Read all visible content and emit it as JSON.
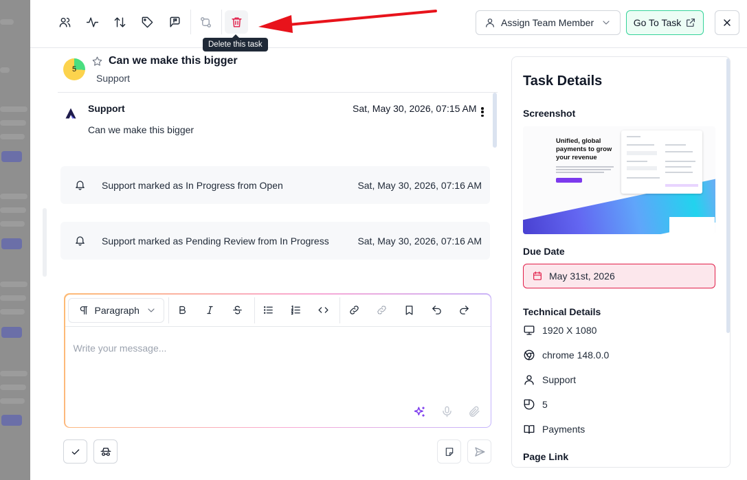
{
  "toolbar": {
    "delete_tooltip": "Delete this task",
    "assign_label": "Assign Team Member",
    "goto_label": "Go To Task"
  },
  "task": {
    "priority": "5",
    "title": "Can we make this bigger",
    "project": "Support"
  },
  "message": {
    "author": "Support",
    "time": "Sat, May 30, 2026, 07:15 AM",
    "body": "Can we make this bigger"
  },
  "events": [
    {
      "text": "Support marked as In Progress from Open",
      "time": "Sat, May 30, 2026, 07:16 AM"
    },
    {
      "text": "Support marked as Pending Review from In Progress",
      "time": "Sat, May 30, 2026, 07:16 AM"
    }
  ],
  "editor": {
    "format_label": "Paragraph",
    "placeholder": "Write your message..."
  },
  "details": {
    "title": "Task Details",
    "screenshot_heading": "Screenshot",
    "screenshot_headline": "Unified, global payments to grow your revenue",
    "due_heading": "Due Date",
    "due_date": "May 31st, 2026",
    "tech_heading": "Technical Details",
    "resolution": "1920 X 1080",
    "browser": "chrome 148.0.0",
    "reporter": "Support",
    "priority": "5",
    "category": "Payments",
    "page_link_heading": "Page Link"
  },
  "colors": {
    "accent_delete": "#e11d48",
    "goto_bg": "#ecfdf5",
    "goto_border": "#34d399",
    "due_bg": "#fce7ec",
    "arrow": "#e8131b"
  }
}
